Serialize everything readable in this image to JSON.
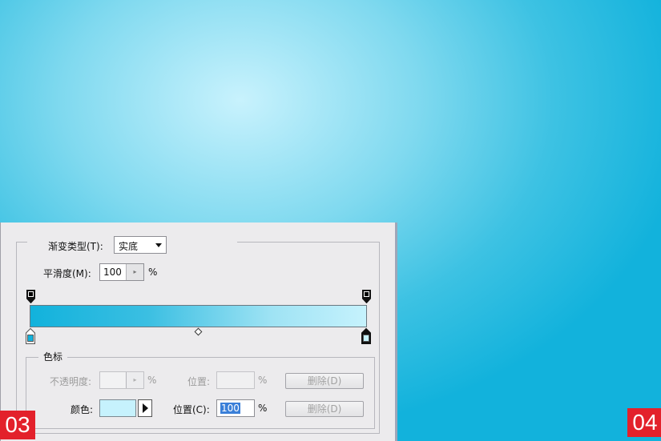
{
  "gradient_editor": {
    "gradient_type_label": "渐变类型(T):",
    "gradient_type_value": "实底",
    "smoothness_label": "平滑度(M):",
    "smoothness_value": "100",
    "smoothness_unit": "%",
    "colors": {
      "left": "#12b2dc",
      "right": "#c6f2fd"
    },
    "color_stops": {
      "group_title": "色标",
      "opacity_label": "不透明度:",
      "opacity_unit": "%",
      "opacity_location_label": "位置:",
      "opacity_location_unit": "%",
      "opacity_delete_label": "删除(D)",
      "color_label": "颜色:",
      "color_swatch": "#c6f2fd",
      "color_location_label": "位置(C):",
      "color_location_value": "100",
      "color_location_unit": "%",
      "color_delete_label": "删除(D)"
    }
  },
  "badges": {
    "left": "03",
    "right": "04"
  }
}
